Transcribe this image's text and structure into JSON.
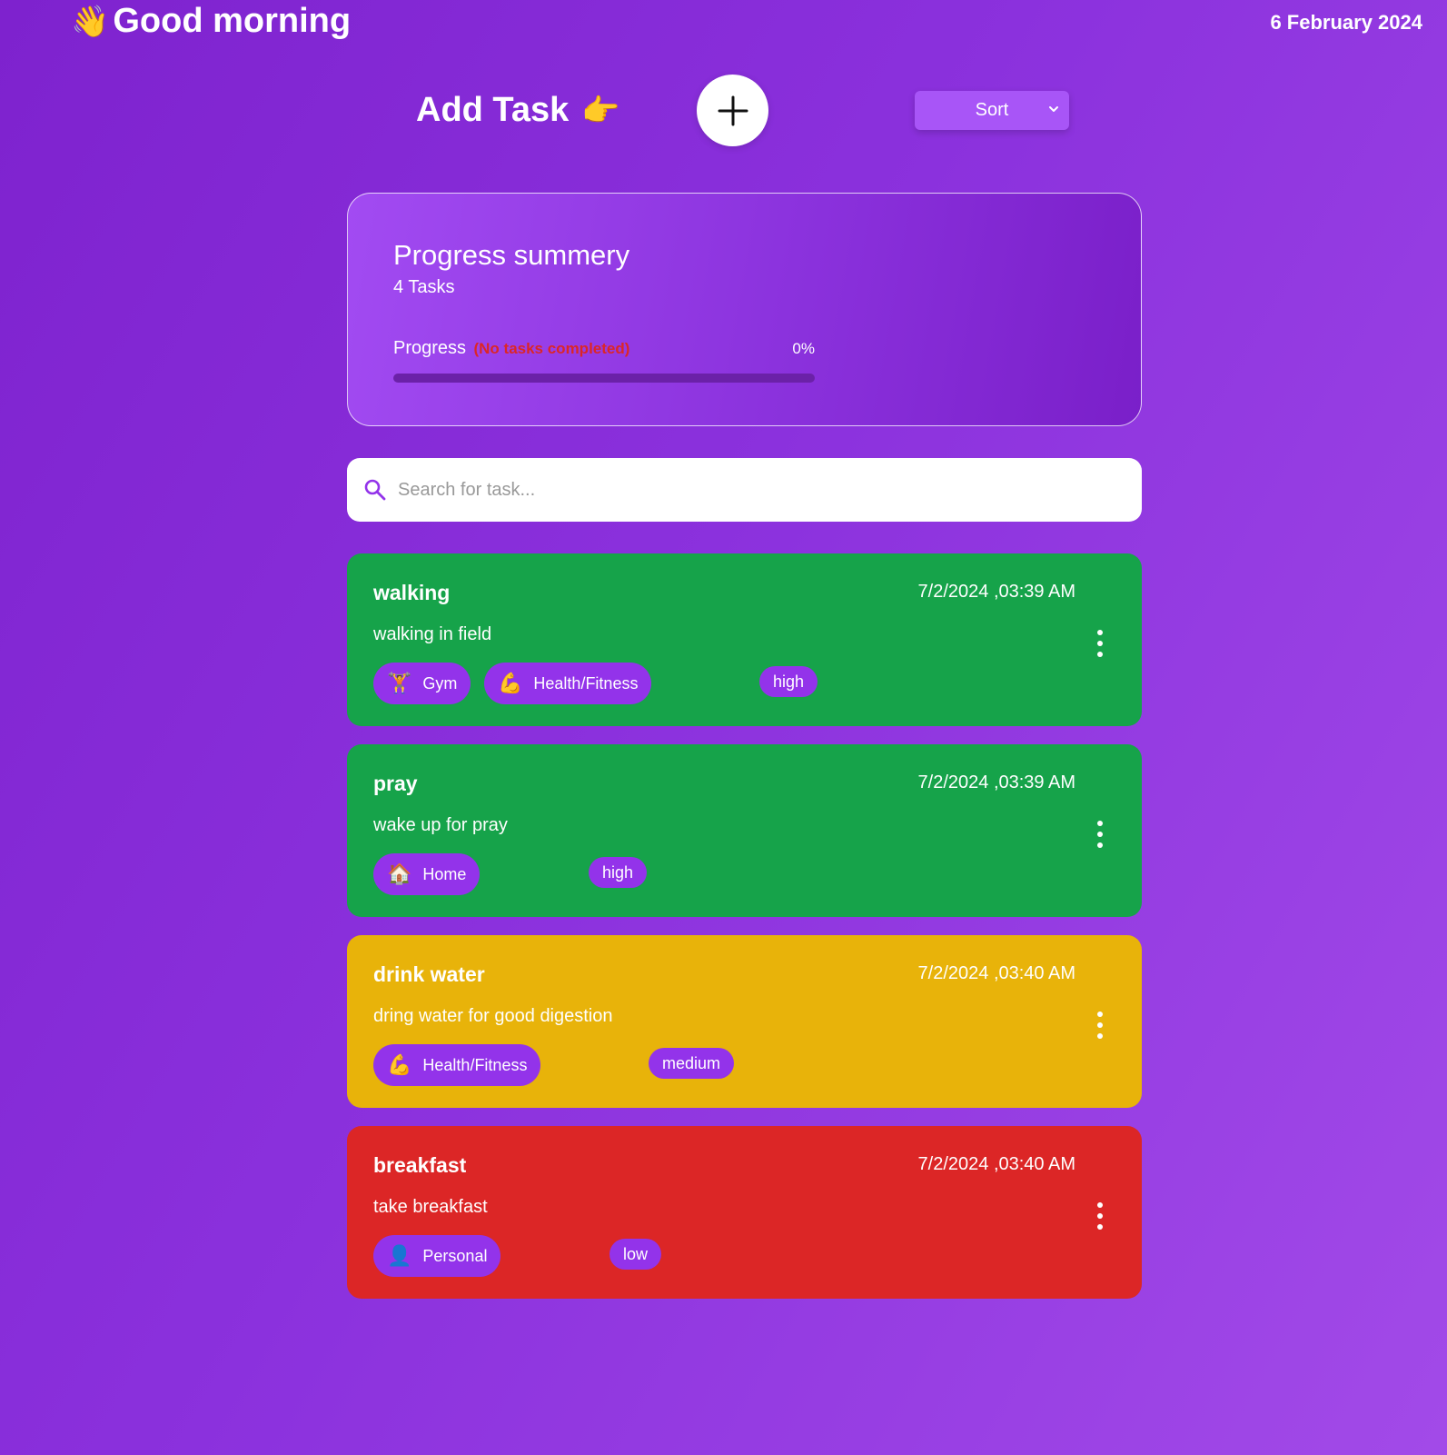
{
  "header": {
    "greeting_emoji": "👋",
    "greeting": "Good morning",
    "date": "6 February 2024"
  },
  "toolbar": {
    "add_task_label": "Add Task",
    "add_task_emoji": "👉",
    "add_button_icon": "plus-icon",
    "sort_label": "Sort"
  },
  "progress": {
    "title": "Progress summery",
    "task_count": "4 Tasks",
    "label": "Progress",
    "note": "(No tasks completed)",
    "percent_text": "0%",
    "fraction": 0
  },
  "search": {
    "placeholder": "Search for task...",
    "value": ""
  },
  "tasks": [
    {
      "title": "walking",
      "date": "7/2/2024 ,03:39 AM",
      "description": "walking in field",
      "color": "#16a34a",
      "categories": [
        {
          "emoji": "🏋️",
          "label": "Gym"
        },
        {
          "emoji": "💪",
          "label": "Health/Fitness"
        }
      ],
      "priority": "high"
    },
    {
      "title": "pray",
      "date": "7/2/2024 ,03:39 AM",
      "description": "wake up for pray",
      "color": "#16a34a",
      "categories": [
        {
          "emoji": "🏠",
          "label": "Home"
        }
      ],
      "priority": "high"
    },
    {
      "title": "drink water",
      "date": "7/2/2024 ,03:40 AM",
      "description": "dring water for good digestion",
      "color": "#e8b30a",
      "categories": [
        {
          "emoji": "💪",
          "label": "Health/Fitness"
        }
      ],
      "priority": "medium"
    },
    {
      "title": "breakfast",
      "date": "7/2/2024 ,03:40 AM",
      "description": "take breakfast",
      "color": "#dc2626",
      "categories": [
        {
          "emoji": "👤",
          "label": "Personal"
        }
      ],
      "priority": "low"
    }
  ]
}
